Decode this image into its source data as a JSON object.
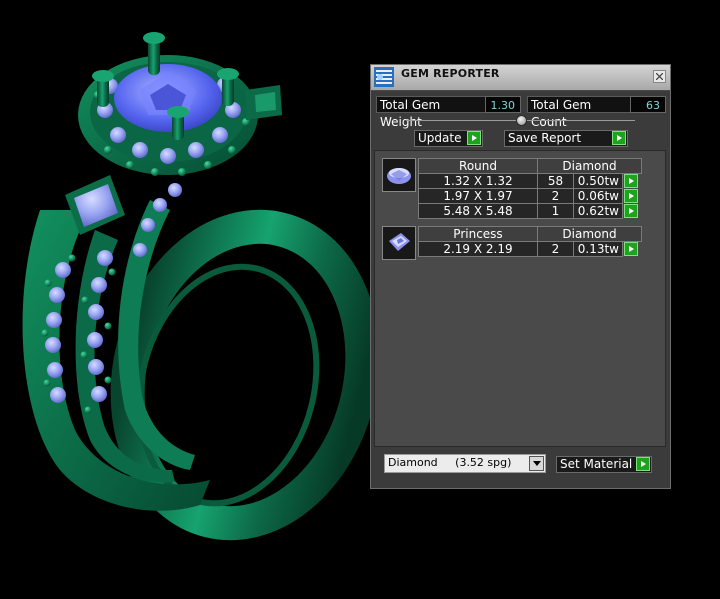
{
  "panel": {
    "title": "GEM REPORTER",
    "total_gem_weight_label": "Total Gem Weight",
    "total_gem_weight_value": "1.30",
    "total_gem_count_label": "Total Gem Count",
    "total_gem_count_value": "63",
    "slider_position": 0.5,
    "update_label": "Update",
    "save_report_label": "Save Report",
    "set_material_label": "Set Material",
    "material_value": "Diamond     (3.52 spg)"
  },
  "gem_groups": [
    {
      "cut": "Round",
      "material": "Diamond",
      "thumb_icon": "round-gem-icon",
      "rows": [
        {
          "size": "1.32 X 1.32",
          "count": "58",
          "weight": "0.50tw"
        },
        {
          "size": "1.97 X 1.97",
          "count": "2",
          "weight": "0.06tw"
        },
        {
          "size": "5.48 X 5.48",
          "count": "1",
          "weight": "0.62tw"
        }
      ]
    },
    {
      "cut": "Princess",
      "material": "Diamond",
      "thumb_icon": "princess-gem-icon",
      "rows": [
        {
          "size": "2.19 X 2.19",
          "count": "2",
          "weight": "0.13tw"
        }
      ]
    }
  ],
  "colors": {
    "ring_metal": "#0f7a55",
    "gem_blue": "#6f78ff",
    "button_green": "#1fa31f",
    "value_text": "#7fd6d6"
  },
  "scene": {
    "object_icon": "ring-3d-render"
  }
}
